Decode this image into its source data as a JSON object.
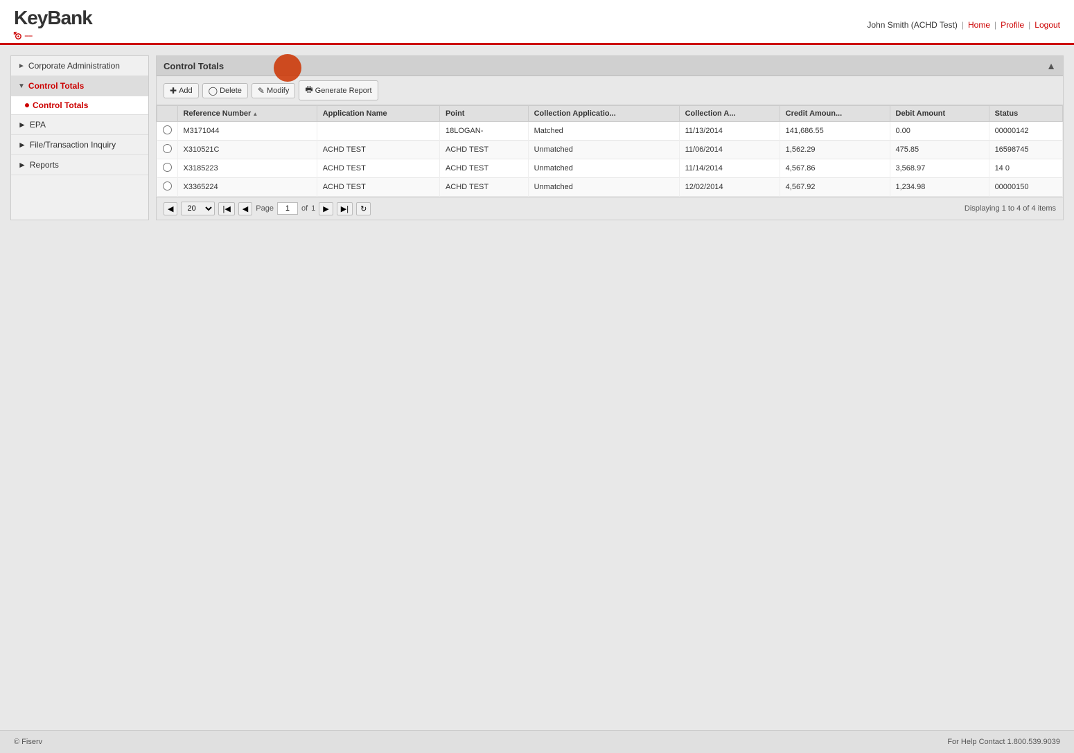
{
  "header": {
    "logo_text": "KeyBank",
    "user_text": "John Smith (ACHD Test)",
    "home_label": "Home",
    "profile_label": "Profile",
    "logout_label": "Logout"
  },
  "sidebar": {
    "items": [
      {
        "id": "corporate-admin",
        "label": "Corporate Administration",
        "type": "section",
        "expanded": false
      },
      {
        "id": "control-totals",
        "label": "Control Totals",
        "type": "parent",
        "expanded": true
      },
      {
        "id": "control-totals-sub",
        "label": "Control Totals",
        "type": "child",
        "active": true
      },
      {
        "id": "epa",
        "label": "EPA",
        "type": "section",
        "expanded": false
      },
      {
        "id": "file-transaction",
        "label": "File/Transaction Inquiry",
        "type": "section",
        "expanded": false
      },
      {
        "id": "reports",
        "label": "Reports",
        "type": "section",
        "expanded": false
      }
    ]
  },
  "content": {
    "title": "Control Totals",
    "toolbar": {
      "add_label": "Add",
      "delete_label": "Delete",
      "modify_label": "Modify",
      "generate_report_label": "Generate Report"
    },
    "table": {
      "columns": [
        {
          "id": "select",
          "label": ""
        },
        {
          "id": "reference_number",
          "label": "Reference Number",
          "sortable": true
        },
        {
          "id": "application_name",
          "label": "Application Name"
        },
        {
          "id": "point",
          "label": "Point"
        },
        {
          "id": "collection_application",
          "label": "Collection Applicatio..."
        },
        {
          "id": "collection_date",
          "label": "Collection A..."
        },
        {
          "id": "credit_amount",
          "label": "Credit Amoun..."
        },
        {
          "id": "debit_amount",
          "label": "Debit Amount"
        },
        {
          "id": "status",
          "label": "Status"
        }
      ],
      "rows": [
        {
          "id": "row1",
          "selected": false,
          "reference_number": "M3171044",
          "application_name": "",
          "point": "18LOGAN-",
          "collection_application": "Matched",
          "collection_date": "11/13/2014",
          "credit_amount": "141,686.55",
          "debit_amount": "0.00",
          "status": "00000142"
        },
        {
          "id": "row2",
          "selected": false,
          "reference_number": "X310521C",
          "application_name": "ACHD TEST",
          "point": "ACHD TEST",
          "collection_application": "Unmatched",
          "collection_date": "11/06/2014",
          "credit_amount": "1,562.29",
          "debit_amount": "475.85",
          "status": "16598745"
        },
        {
          "id": "row3",
          "selected": false,
          "reference_number": "X3185223",
          "application_name": "ACHD TEST",
          "point": "ACHD TEST",
          "collection_application": "Unmatched",
          "collection_date": "11/14/2014",
          "credit_amount": "4,567.86",
          "debit_amount": "3,568.97",
          "status": "14 0"
        },
        {
          "id": "row4",
          "selected": false,
          "reference_number": "X3365224",
          "application_name": "ACHD TEST",
          "point": "ACHD TEST",
          "collection_application": "Unmatched",
          "collection_date": "12/02/2014",
          "credit_amount": "4,567.92",
          "debit_amount": "1,234.98",
          "status": "00000150"
        }
      ]
    },
    "pagination": {
      "page_size": "20",
      "current_page": "1",
      "total_pages": "1",
      "page_label": "Page",
      "of_label": "of",
      "displaying_text": "Displaying 1 to 4 of 4 items"
    }
  },
  "footer": {
    "copyright": "© Fiserv",
    "help_text": "For Help Contact 1.800.539.9039"
  }
}
